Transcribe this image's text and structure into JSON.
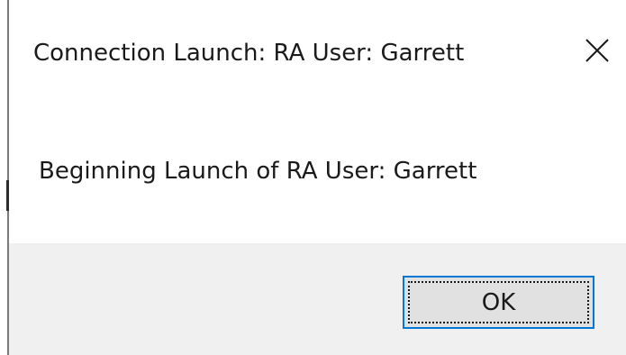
{
  "dialog": {
    "title": "Connection Launch: RA User: Garrett",
    "close_icon": "close-icon",
    "message": "Beginning Launch of RA User: Garrett",
    "ok_label": "OK"
  },
  "colors": {
    "content_bg": "#ffffff",
    "footer_bg": "#f0f0f0",
    "button_bg": "#e1e1e1",
    "button_focus_border": "#0078d7",
    "text": "#1a1a1a"
  }
}
